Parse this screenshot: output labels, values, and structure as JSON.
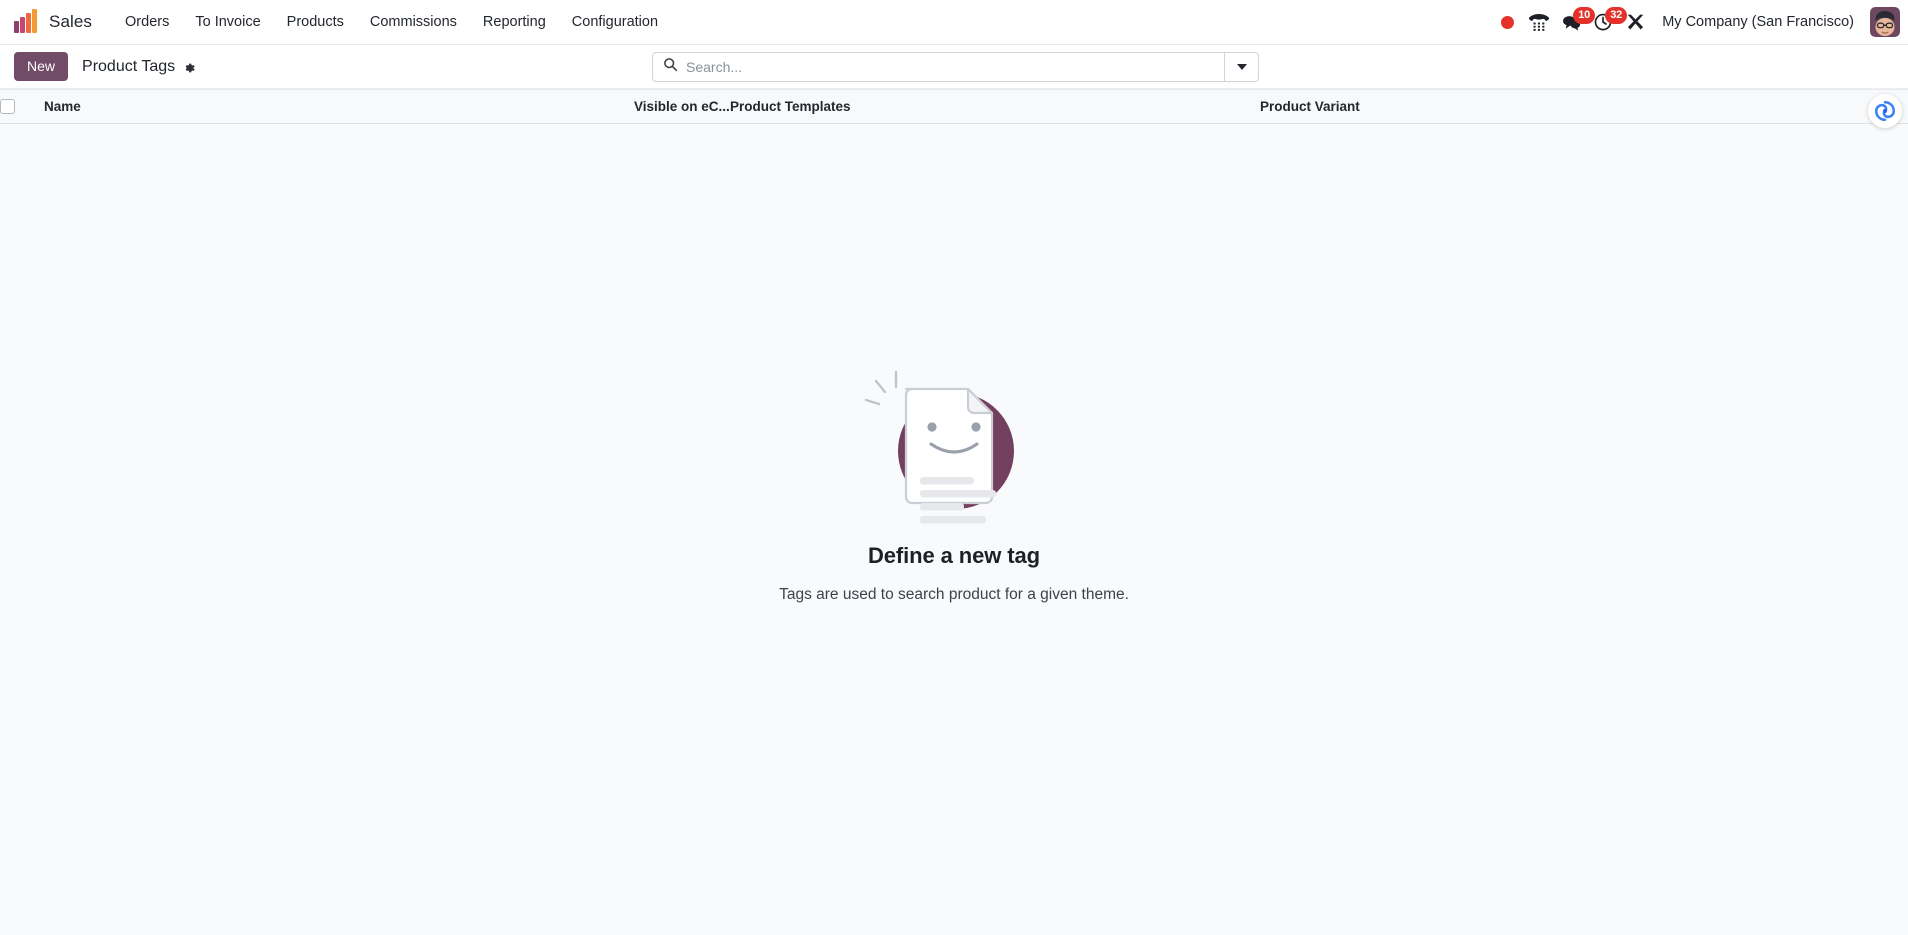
{
  "navbar": {
    "logo_icon": "sales-bar-chart-logo",
    "app_name": "Sales",
    "menu": [
      {
        "label": "Orders",
        "name": "menu-orders"
      },
      {
        "label": "To Invoice",
        "name": "menu-to-invoice"
      },
      {
        "label": "Products",
        "name": "menu-products"
      },
      {
        "label": "Commissions",
        "name": "menu-commissions"
      },
      {
        "label": "Reporting",
        "name": "menu-reporting"
      },
      {
        "label": "Configuration",
        "name": "menu-configuration"
      }
    ],
    "systray": {
      "recording_icon": "record-dot-icon",
      "phone_icon": "phone-dialpad-icon",
      "messages_icon": "chat-bubble-icon",
      "messages_count": "10",
      "activities_icon": "clock-activity-icon",
      "activities_count": "32",
      "tools_icon": "crossed-tools-icon",
      "company": "My Company (San Francisco)",
      "avatar_icon": "user-avatar"
    },
    "colors": {
      "badge_red": "#E4322B",
      "brand_purple": "#714B67"
    }
  },
  "control_panel": {
    "new_label": "New",
    "breadcrumb": "Product Tags",
    "gear_icon": "gear-icon",
    "search": {
      "placeholder": "Search...",
      "value": "",
      "search_icon": "search-icon",
      "toggle_icon": "chevron-down-icon"
    }
  },
  "list": {
    "columns": [
      {
        "label": "",
        "name": "column-select-all"
      },
      {
        "label": "Name",
        "name": "column-name"
      },
      {
        "label": "Visible on eC...",
        "name": "column-visible-on-ecommerce"
      },
      {
        "label": "Product Templates",
        "name": "column-product-templates"
      },
      {
        "label": "Product Variant",
        "name": "column-product-variant"
      }
    ],
    "rows": []
  },
  "empty_state": {
    "illustration": "smiling-document-illustration",
    "title": "Define a new tag",
    "subtitle": "Tags are used to search product for a given theme."
  },
  "ai_assistant": {
    "icon": "ai-swirl-icon"
  }
}
